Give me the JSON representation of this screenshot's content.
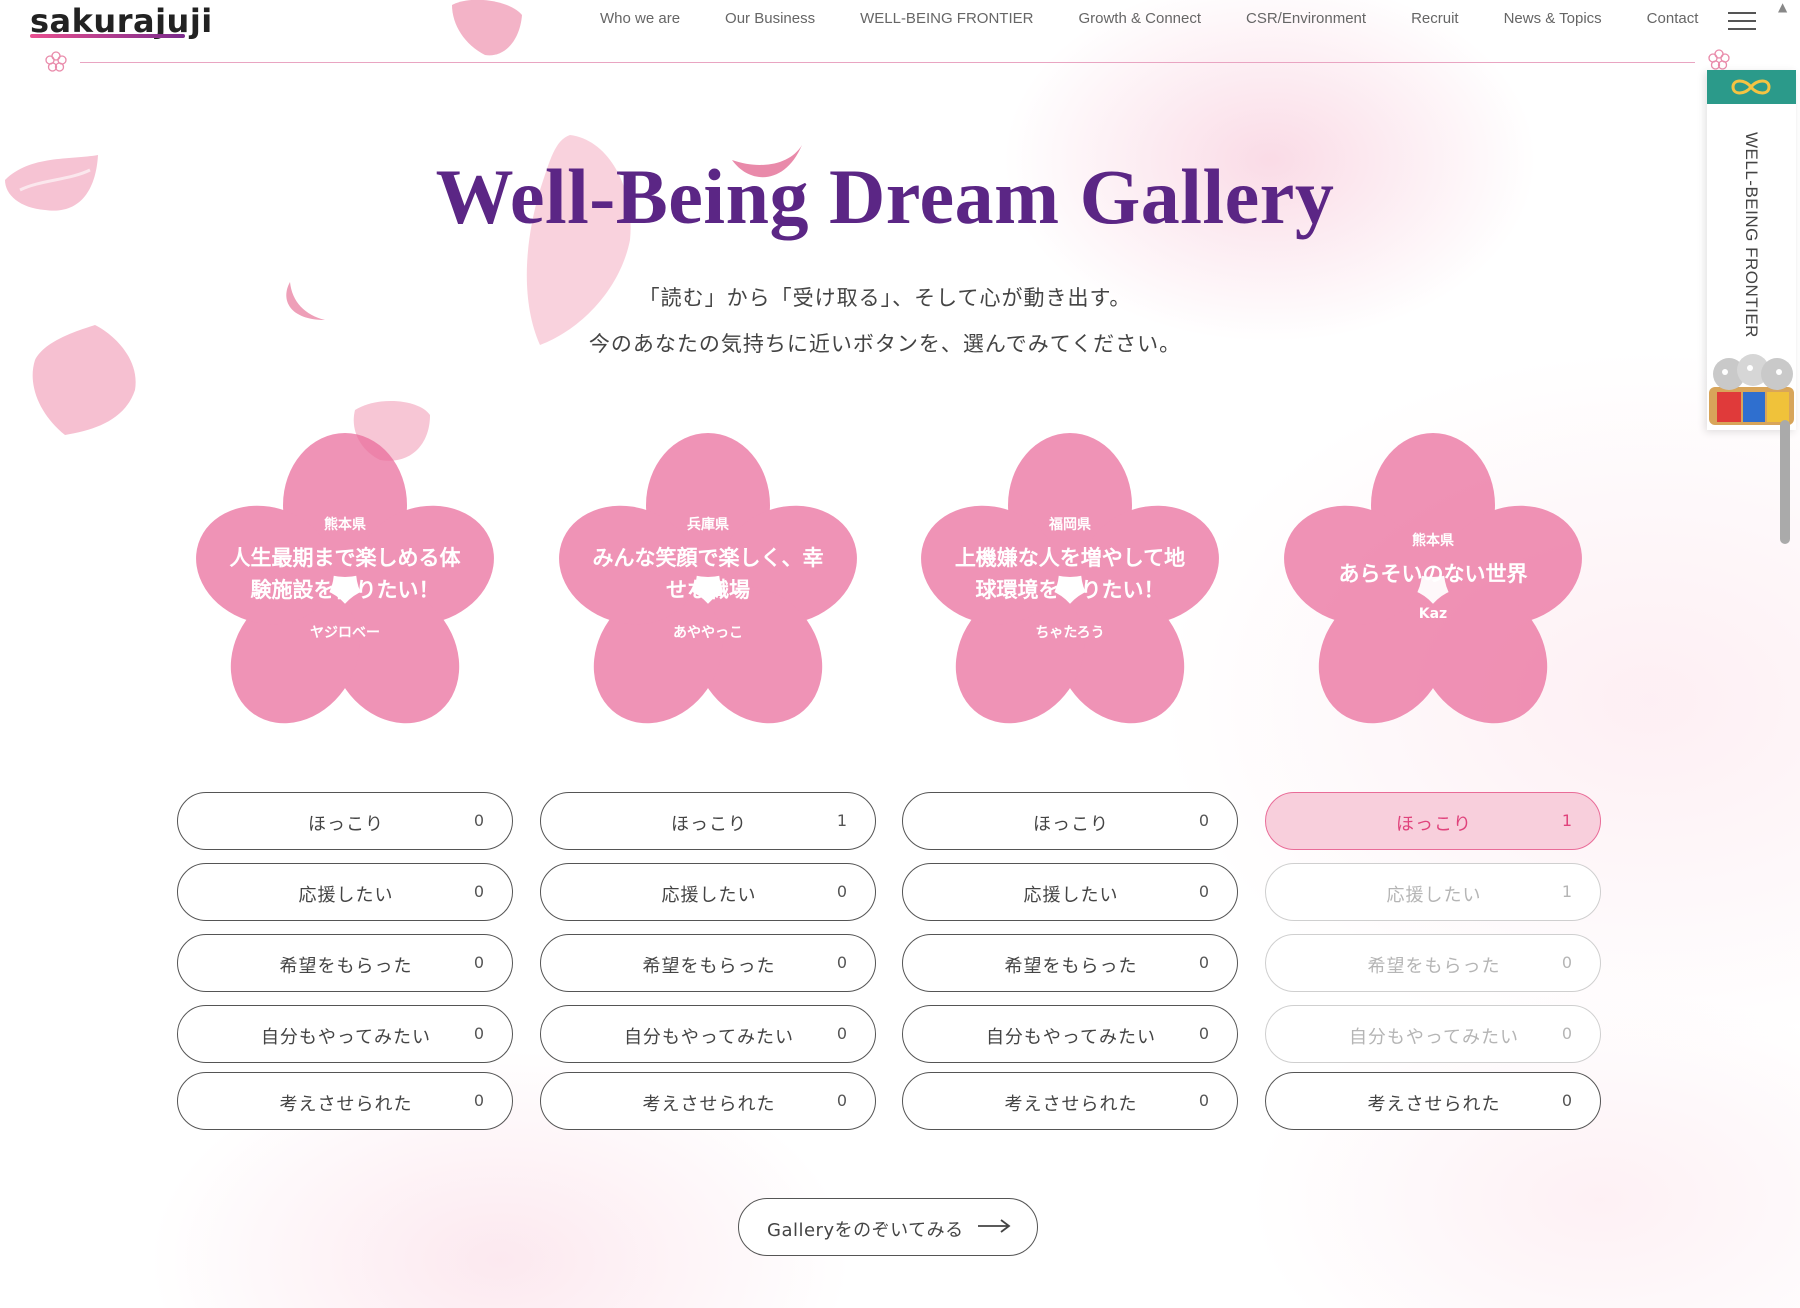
{
  "header": {
    "logo_text": "sakurajuji",
    "nav": [
      "Who we are",
      "Our Business",
      "WELL-BEING FRONTIER",
      "Growth & Connect",
      "CSR/Environment",
      "Recruit",
      "News & Topics",
      "Contact"
    ],
    "menu_icon": "hamburger-icon"
  },
  "side_tab": {
    "label": "WELL-BEING FRONTIER",
    "icons": [
      "infinity-icon",
      "mascot-illustration"
    ]
  },
  "main": {
    "title": "Well-Being Dream Gallery",
    "lead_line1": "「読む」から「受け取る」、そして心が動き出す。",
    "lead_line2": "今のあなたの気持ちに近いボタンを、選んでみてください。"
  },
  "dreams": [
    {
      "prefecture": "熊本県",
      "dream_line1": "人生最期まで楽しめる体",
      "dream_line2": "験施設を作りたい！",
      "nickname": "ヤジロベー",
      "reactions": [
        {
          "label": "ほっこり",
          "count": "0"
        },
        {
          "label": "応援したい",
          "count": "0"
        },
        {
          "label": "希望をもらった",
          "count": "0"
        },
        {
          "label": "自分もやってみたい",
          "count": "0"
        },
        {
          "label": "考えさせられた",
          "count": "0"
        }
      ]
    },
    {
      "prefecture": "兵庫県",
      "dream_line1": "みんな笑顔で楽しく、幸",
      "dream_line2": "せな職場",
      "nickname": "あややっこ",
      "reactions": [
        {
          "label": "ほっこり",
          "count": "1"
        },
        {
          "label": "応援したい",
          "count": "0"
        },
        {
          "label": "希望をもらった",
          "count": "0"
        },
        {
          "label": "自分もやってみたい",
          "count": "0"
        },
        {
          "label": "考えさせられた",
          "count": "0"
        }
      ]
    },
    {
      "prefecture": "福岡県",
      "dream_line1": "上機嫌な人を増やして地",
      "dream_line2": "球環境を守りたい！",
      "nickname": "ちゃたろう",
      "reactions": [
        {
          "label": "ほっこり",
          "count": "0"
        },
        {
          "label": "応援したい",
          "count": "0"
        },
        {
          "label": "希望をもらった",
          "count": "0"
        },
        {
          "label": "自分もやってみたい",
          "count": "0"
        },
        {
          "label": "考えさせられた",
          "count": "0"
        }
      ]
    },
    {
      "prefecture": "熊本県",
      "dream_line1": "あらそいのない世界",
      "dream_line2": "",
      "nickname": "Kaz",
      "reactions": [
        {
          "label": "ほっこり",
          "count": "1",
          "state": "active"
        },
        {
          "label": "応援したい",
          "count": "1",
          "state": "disabled"
        },
        {
          "label": "希望をもらった",
          "count": "0",
          "state": "disabled"
        },
        {
          "label": "自分もやってみたい",
          "count": "0",
          "state": "disabled"
        },
        {
          "label": "考えさせられた",
          "count": "0"
        }
      ]
    }
  ],
  "gallery_button": {
    "label": "Galleryをのぞいてみる",
    "icon": "arrow-right-icon"
  },
  "colors": {
    "title": "#5b2685",
    "accent_pink": "#e0437c",
    "active_bg": "#f8cfdc",
    "side_tab_top": "#2b9a8a"
  }
}
